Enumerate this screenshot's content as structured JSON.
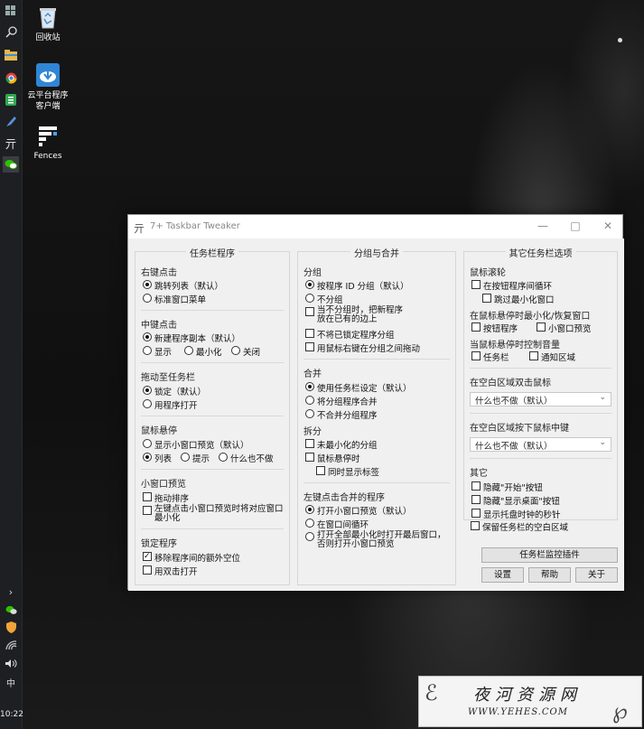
{
  "desktop": {
    "icons": [
      {
        "label": "回收站",
        "icon": "recycle-bin-icon"
      },
      {
        "label": "云平台程序\n客户端",
        "icon": "cloud-client-icon"
      },
      {
        "label": "Fences",
        "icon": "fences-icon"
      }
    ]
  },
  "taskbar": {
    "clock": "10:22",
    "ime": "中",
    "icons": [
      "windows-logo-icon",
      "search-icon",
      "file-explorer-icon",
      "chrome-icon",
      "green-app-icon",
      "pen-icon",
      "chinese-app-icon",
      "wechat-icon"
    ],
    "tray_icons": [
      "chevron-right-icon",
      "wechat-tray-icon",
      "shield-tray-icon",
      "wifi-icon",
      "volume-icon"
    ]
  },
  "window": {
    "title": "7+ Taskbar Tweaker",
    "col1": {
      "title": "任务栏程序",
      "right_click": {
        "label": "右键点击",
        "options": [
          "跳转列表（默认）",
          "标准窗口菜单"
        ],
        "selected": 0
      },
      "middle_click": {
        "label": "中键点击",
        "options": [
          "新建程序副本（默认）",
          "显示",
          "最小化",
          "关闭"
        ],
        "selected": 0
      },
      "drag_to_taskbar": {
        "label": "拖动至任务栏",
        "options": [
          "锁定（默认）",
          "用程序打开"
        ],
        "selected": 0
      },
      "hover": {
        "label": "鼠标悬停",
        "options": [
          "显示小窗口预览（默认）",
          "列表",
          "提示",
          "什么也不做"
        ],
        "selected": 1
      },
      "thumbnail": {
        "label": "小窗口预览",
        "checks": [
          {
            "label": "拖动排序",
            "checked": false
          },
          {
            "label": "左键点击小窗口预览时将对应窗口\n最小化",
            "checked": false
          }
        ]
      },
      "pinned": {
        "label": "锁定程序",
        "checks": [
          {
            "label": "移除程序间的额外空位",
            "checked": true
          },
          {
            "label": "用双击打开",
            "checked": false
          }
        ]
      }
    },
    "col2": {
      "title": "分组与合并",
      "grouping": {
        "label": "分组",
        "options": [
          "按程序 ID 分组（默认）",
          "不分组"
        ],
        "selected": 0,
        "checks": [
          {
            "label": "当不分组时，把新程序\n放在已有的边上",
            "checked": false
          },
          {
            "label": "不将已锁定程序分组",
            "checked": false
          },
          {
            "label": "用鼠标右键在分组之间拖动",
            "checked": false
          }
        ]
      },
      "combining": {
        "label": "合并",
        "options": [
          "使用任务栏设定（默认）",
          "将分组程序合并",
          "不合并分组程序"
        ],
        "selected": 0
      },
      "decombine": {
        "label": "拆分",
        "checks": [
          {
            "label": "未最小化的分组",
            "checked": false
          },
          {
            "label": "鼠标悬停时",
            "checked": false
          },
          {
            "label": "同时显示标签",
            "checked": false
          }
        ]
      },
      "left_click_combined": {
        "label": "左键点击合并的程序",
        "options": [
          "打开小窗口预览（默认）",
          "在窗口间循环",
          "打开全部最小化时打开最后窗口，\n否则打开小窗口预览"
        ],
        "selected": 0
      }
    },
    "col3": {
      "title": "其它任务栏选项",
      "wheel": {
        "label": "鼠标滚轮",
        "checks": [
          {
            "label": "在按钮程序间循环",
            "checked": false
          },
          {
            "label": "跳过最小化窗口",
            "checked": false
          }
        ]
      },
      "wheel_minimize": {
        "label": "在鼠标悬停时最小化/恢复窗口",
        "checks": [
          {
            "label": "按钮程序",
            "checked": false
          },
          {
            "label": "小窗口预览",
            "checked": false
          }
        ]
      },
      "wheel_volume": {
        "label": "当鼠标悬停时控制音量",
        "checks": [
          {
            "label": "任务栏",
            "checked": false
          },
          {
            "label": "通知区域",
            "checked": false
          }
        ]
      },
      "empty_double_click": {
        "label": "在空白区域双击鼠标",
        "value": "什么也不做（默认）"
      },
      "empty_middle_click": {
        "label": "在空白区域按下鼠标中键",
        "value": "什么也不做（默认）"
      },
      "other": {
        "label": "其它",
        "checks": [
          {
            "label": "隐藏\"开始\"按钮",
            "checked": false
          },
          {
            "label": "隐藏\"显示桌面\"按钮",
            "checked": false
          },
          {
            "label": "显示托盘时钟的秒针",
            "checked": false
          },
          {
            "label": "保留任务栏的空白区域",
            "checked": false
          }
        ]
      },
      "inspector_button": "任务栏监控插件",
      "buttons": [
        "设置",
        "帮助",
        "关于"
      ]
    }
  },
  "watermark": {
    "line1": "夜河资源网",
    "line2": "WWW.YEHES.COM"
  }
}
